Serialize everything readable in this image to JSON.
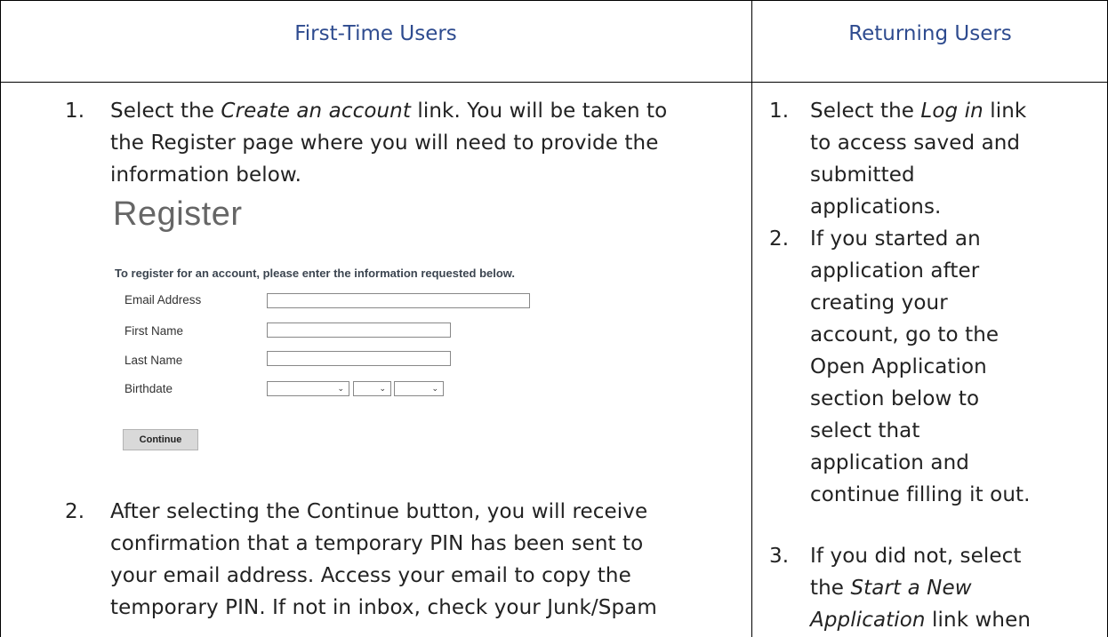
{
  "table": {
    "col1_header": "First-Time Users",
    "col2_header": "Returning Users"
  },
  "first_time": {
    "step1": {
      "num": "1.",
      "line1_a": "Select the ",
      "line1_em": "Create an account",
      "line1_b": " link. You will be taken to",
      "line2": "the Register page where you will need to provide the",
      "line3": "information below."
    },
    "register": {
      "title": "Register",
      "subtitle": "To register for an account, please enter the information requested below.",
      "email_label": "Email Address",
      "first_name_label": "First Name",
      "last_name_label": "Last Name",
      "birthdate_label": "Birthdate",
      "continue_label": "Continue",
      "chevron": "⌄"
    },
    "step2": {
      "num": "2.",
      "line1": "After selecting the Continue button, you will receive",
      "line2": "confirmation that a temporary PIN has been sent to",
      "line3": "your email address. Access your email to copy the",
      "line4": "temporary PIN. If not in inbox, check your Junk/Spam"
    }
  },
  "returning": {
    "step1": {
      "num": "1.",
      "line1_a": "Select the ",
      "line1_em": "Log in",
      "line1_b": " link",
      "line2": "to access saved and",
      "line3": "submitted",
      "line4": "applications."
    },
    "step2": {
      "num": "2.",
      "line1": "If you started an",
      "line2": "application after",
      "line3": "creating your",
      "line4": "account, go to the",
      "line5": "Open Application",
      "line6": "section below to",
      "line7": "select that",
      "line8": "application and",
      "line9": "continue filling it out."
    },
    "step3": {
      "num": "3.",
      "line1": "If you did not, select",
      "line2_a": "the ",
      "line2_em": "Start a New",
      "line3_em": "Application",
      "line3_b": " link when"
    }
  },
  "colors": {
    "header_text": "#2E4B8F",
    "border": "#000000"
  }
}
